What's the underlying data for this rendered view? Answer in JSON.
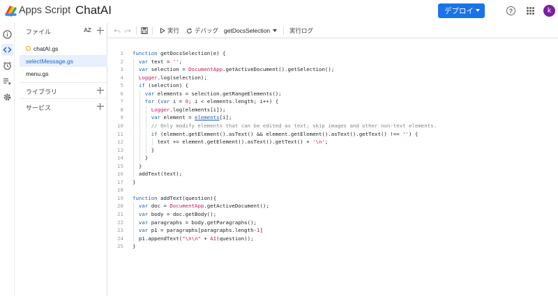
{
  "header": {
    "app_name": "Apps Script",
    "project_title": "ChatAI",
    "deploy_label": "デプロイ",
    "avatar_letter": "k",
    "colors": {
      "deploy_bg": "#1a73e8",
      "avatar_bg": "#7b1fa2"
    }
  },
  "rail": {
    "icons": [
      "info-icon",
      "code-icon",
      "alarm-icon",
      "executions-icon",
      "settings-icon"
    ]
  },
  "files_panel": {
    "title": "ファイル",
    "sort_label": "AZ",
    "files": [
      {
        "name": "chatAI.gs",
        "warning": true,
        "selected": false
      },
      {
        "name": "selectMessage.gs",
        "warning": false,
        "selected": true
      },
      {
        "name": "menu.gs",
        "warning": false,
        "selected": false
      }
    ],
    "libraries_label": "ライブラリ",
    "services_label": "サービス"
  },
  "toolbar": {
    "run_label": "実行",
    "debug_label": "デバッグ",
    "function_name": "getDocsSelection",
    "log_label": "実行ログ"
  },
  "editor": {
    "lines": [
      {
        "n": "1",
        "indent": 0,
        "html": "<span class=\"kw\">function</span> getDocsSelection(e) {"
      },
      {
        "n": "2",
        "indent": 1,
        "html": "<span class=\"kw\">var</span> text = <span class=\"str\">''</span>;"
      },
      {
        "n": "3",
        "indent": 1,
        "html": "<span class=\"kw\">var</span> selection = <span class=\"cls\">DocumentApp</span>.getActiveDocument().getSelection();"
      },
      {
        "n": "4",
        "indent": 1,
        "html": "<span class=\"cls\">Logger</span>.log(selection);"
      },
      {
        "n": "5",
        "indent": 1,
        "html": "<span class=\"kw\">if</span> (selection) {"
      },
      {
        "n": "6",
        "indent": 2,
        "html": "<span class=\"kw\">var</span> elements = selection.getRangeElements();"
      },
      {
        "n": "7",
        "indent": 2,
        "html": "<span class=\"kw\">for</span> (<span class=\"kw\">var</span> i = <span class=\"num\">0</span>; i &lt; elements.length; i++) {"
      },
      {
        "n": "8",
        "indent": 3,
        "html": "<span class=\"cls\">Logger</span>.log(elements[i]);"
      },
      {
        "n": "9",
        "indent": 3,
        "html": "<span class=\"kw\">var</span> element = <span class=\"ul\">elements</span>[i];"
      },
      {
        "n": "10",
        "indent": 3,
        "html": "<span class=\"cm\">// Only modify elements that can be edited as text; skip images and other non-text elements.</span>"
      },
      {
        "n": "11",
        "indent": 3,
        "html": "<span class=\"kw\">if</span> (element.getElement().asText() &amp;&amp; element.getElement().asText().getText() !== <span class=\"str\">''</span>) {"
      },
      {
        "n": "12",
        "indent": 4,
        "html": "text += element.getElement().asText().getText() + <span class=\"str\">'\\n'</span>;"
      },
      {
        "n": "13",
        "indent": 3,
        "html": "}"
      },
      {
        "n": "14",
        "indent": 2,
        "html": "}"
      },
      {
        "n": "15",
        "indent": 1,
        "html": "}"
      },
      {
        "n": "16",
        "indent": 1,
        "html": "addText(text);"
      },
      {
        "n": "17",
        "indent": 0,
        "html": "}"
      },
      {
        "n": "18",
        "indent": 0,
        "html": ""
      },
      {
        "n": "19",
        "indent": 0,
        "html": "<span class=\"kw\">function</span> addText(question){"
      },
      {
        "n": "20",
        "indent": 1,
        "html": "<span class=\"kw\">var</span> doc = <span class=\"cls\">DocumentApp</span>.getActiveDocument();"
      },
      {
        "n": "21",
        "indent": 1,
        "html": "<span class=\"kw\">var</span> body = doc.getBody();"
      },
      {
        "n": "22",
        "indent": 1,
        "html": "<span class=\"kw\">var</span> paragraphs = body.getParagraphs();"
      },
      {
        "n": "23",
        "indent": 1,
        "html": "<span class=\"kw\">var</span> p1 = paragraphs[paragraphs.length-<span class=\"num\">1</span>]"
      },
      {
        "n": "24",
        "indent": 1,
        "html": "p1.appendText(<span class=\"str\">\"\\n\\n\"</span> + <span class=\"cls\">AI</span>(question));"
      },
      {
        "n": "25",
        "indent": 0,
        "html": "}"
      }
    ]
  }
}
